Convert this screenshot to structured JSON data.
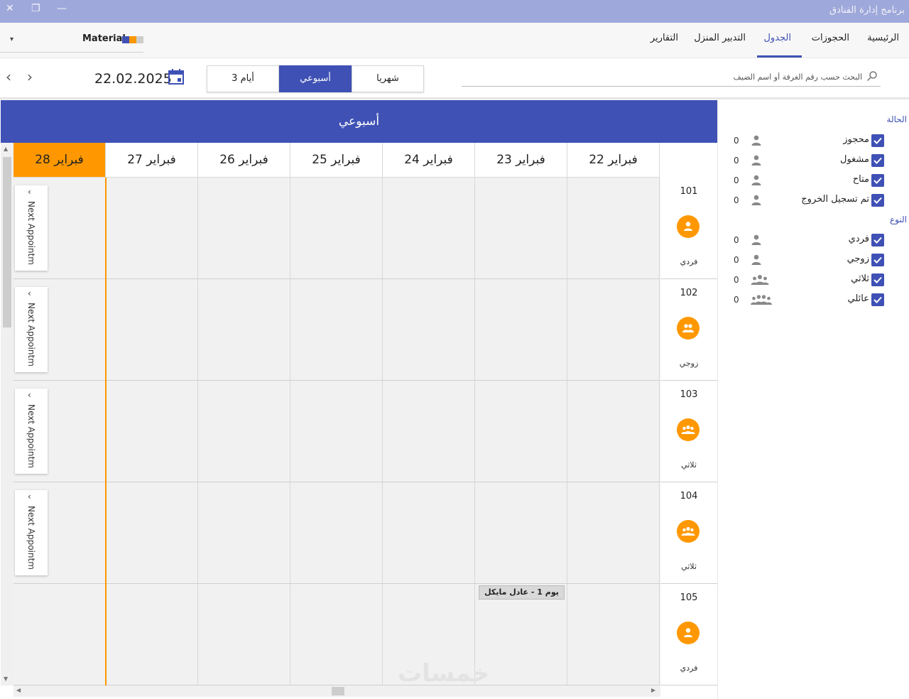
{
  "window": {
    "title": "برنامج إدارة الفنادق",
    "close_glyph": "✕",
    "restore_glyph": "❐",
    "minimize_glyph": "—"
  },
  "nav": {
    "tabs": [
      {
        "label": "الرئيسية",
        "active": false
      },
      {
        "label": "الحجوزات",
        "active": false
      },
      {
        "label": "الجدول",
        "active": true
      },
      {
        "label": "التدبير المنزل",
        "active": false
      },
      {
        "label": "التقارير",
        "active": false
      }
    ],
    "theme": {
      "label": "Material",
      "caret": "▾",
      "swatches": [
        "#3f51b5",
        "#ff9800",
        "#cccccc"
      ]
    }
  },
  "toolbar": {
    "prev": "‹",
    "next": "›",
    "date": "22.02.2025",
    "views": [
      {
        "label": "شهريا",
        "active": false
      },
      {
        "label": "أسبوعي",
        "active": true
      },
      {
        "label": "3 أيام",
        "active": false
      }
    ],
    "search_placeholder": "البحث حسب رقم الغرفة أو اسم الضيف"
  },
  "schedule": {
    "header": "أسبوعي",
    "days": [
      "22 فبراير",
      "23 فبراير",
      "24 فبراير",
      "25 فبراير",
      "26 فبراير",
      "27 فبراير",
      "28 فبراير"
    ],
    "today_index": 6,
    "next_label": "Next Appointm",
    "next_chevron": "‹",
    "rooms": [
      {
        "number": "101",
        "type": "فردي",
        "icon": "person-icon"
      },
      {
        "number": "102",
        "type": "زوجي",
        "icon": "couple-icon"
      },
      {
        "number": "103",
        "type": "ثلاثي",
        "icon": "group-icon"
      },
      {
        "number": "104",
        "type": "ثلاثي",
        "icon": "group-icon"
      },
      {
        "number": "105",
        "type": "فردي",
        "icon": "person-icon"
      }
    ],
    "bookings": [
      {
        "label": "يوم 1 - عادل مايكل",
        "room": "105",
        "day": "23 فبراير"
      }
    ]
  },
  "filters": {
    "status_title": "الحالة",
    "status": [
      {
        "label": "محجوز",
        "count": "0",
        "checked": true
      },
      {
        "label": "مشغول",
        "count": "0",
        "checked": true
      },
      {
        "label": "متاح",
        "count": "0",
        "checked": true
      },
      {
        "label": "تم تسجيل الخروج",
        "count": "0",
        "checked": true
      }
    ],
    "type_title": "النوع",
    "types": [
      {
        "label": "فردي",
        "count": "0",
        "checked": true,
        "icon": "person-icon"
      },
      {
        "label": "زوجي",
        "count": "0",
        "checked": true,
        "icon": "person-icon"
      },
      {
        "label": "ثلاثي",
        "count": "0",
        "checked": true,
        "icon": "group-icon"
      },
      {
        "label": "عائلي",
        "count": "0",
        "checked": true,
        "icon": "family-icon"
      }
    ]
  },
  "watermark": "خمسات",
  "colors": {
    "primary": "#3f51b5",
    "accent": "#ff9800",
    "titlebar": "#9fa8da"
  }
}
